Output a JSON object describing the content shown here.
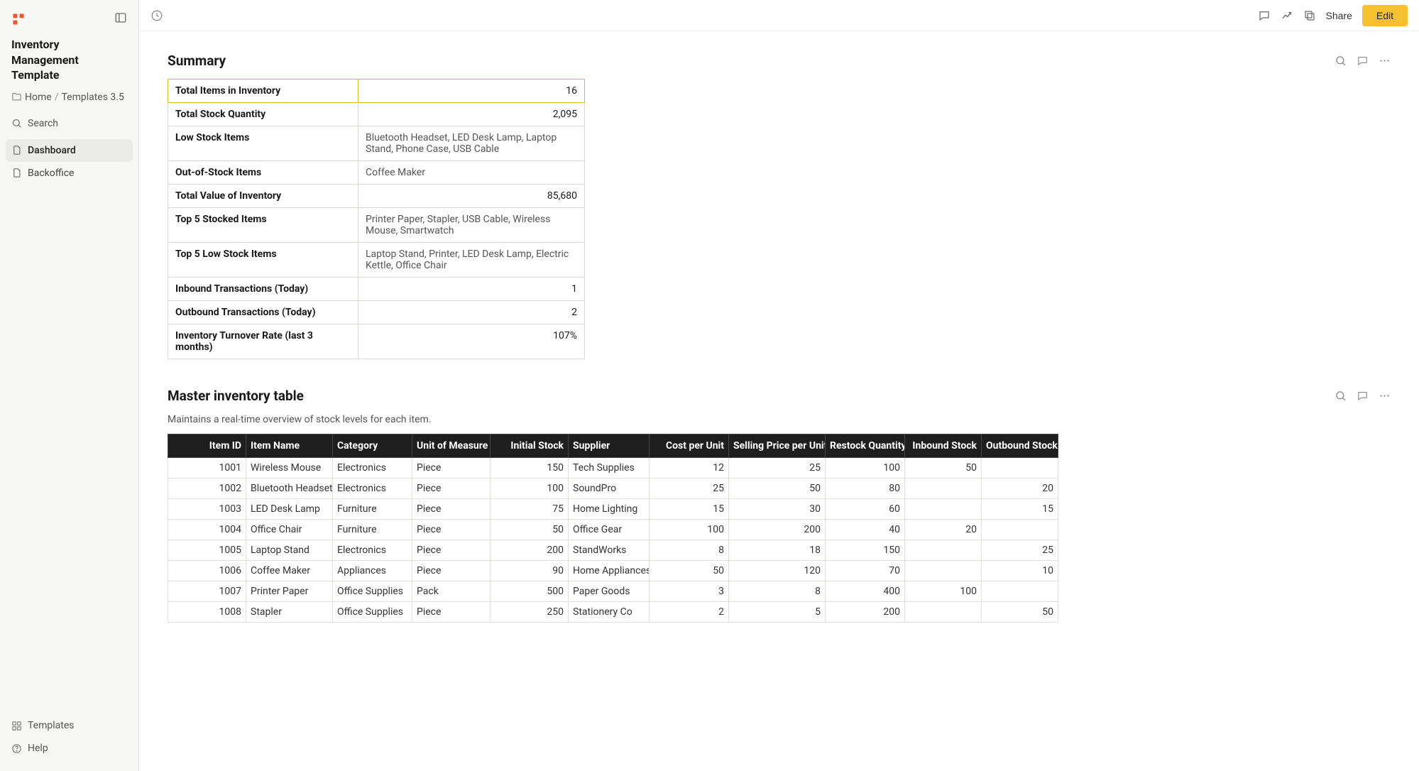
{
  "sidebar": {
    "title": "Inventory Management Template",
    "breadcrumb": {
      "home": "Home",
      "sep": "/",
      "current": "Templates 3.5"
    },
    "search": "Search",
    "nav": [
      {
        "label": "Dashboard",
        "active": true
      },
      {
        "label": "Backoffice",
        "active": false
      }
    ],
    "bottom": [
      {
        "label": "Templates"
      },
      {
        "label": "Help"
      }
    ]
  },
  "topbar": {
    "share": "Share",
    "edit": "Edit"
  },
  "summary": {
    "title": "Summary",
    "rows": [
      {
        "label": "Total Items in Inventory",
        "value": "16",
        "type": "num"
      },
      {
        "label": "Total Stock Quantity",
        "value": "2,095",
        "type": "num"
      },
      {
        "label": "Low Stock Items",
        "value": "Bluetooth Headset, LED Desk Lamp, Laptop Stand, Phone Case, USB Cable",
        "type": "txt"
      },
      {
        "label": "Out-of-Stock Items",
        "value": "Coffee Maker",
        "type": "txt"
      },
      {
        "label": "Total Value of Inventory",
        "value": "85,680",
        "type": "num"
      },
      {
        "label": "Top 5 Stocked Items",
        "value": "Printer Paper, Stapler, USB Cable, Wireless Mouse, Smartwatch",
        "type": "txt"
      },
      {
        "label": "Top 5 Low Stock Items",
        "value": "Laptop Stand, Printer, LED Desk Lamp, Electric Kettle, Office Chair",
        "type": "txt"
      },
      {
        "label": "Inbound Transactions (Today)",
        "value": "1",
        "type": "num"
      },
      {
        "label": "Outbound Transactions (Today)",
        "value": "2",
        "type": "num"
      },
      {
        "label": "Inventory Turnover Rate (last 3 months)",
        "value": "107%",
        "type": "num"
      }
    ]
  },
  "master": {
    "title": "Master inventory table",
    "desc": "Maintains a real-time overview of stock levels for each item.",
    "headers": [
      "Item ID",
      "Item Name",
      "Category",
      "Unit of Measure",
      "Initial Stock",
      "Supplier",
      "Cost per Unit",
      "Selling Price per Unit",
      "Restock Quantity",
      "Inbound Stock",
      "Outbound Stock"
    ],
    "rows": [
      {
        "id": "1001",
        "name": "Wireless Mouse",
        "cat": "Electronics",
        "uom": "Piece",
        "init": "150",
        "supp": "Tech Supplies",
        "cpu": "12",
        "spu": "25",
        "rq": "100",
        "in": "50",
        "out": ""
      },
      {
        "id": "1002",
        "name": "Bluetooth Headset",
        "cat": "Electronics",
        "uom": "Piece",
        "init": "100",
        "supp": "SoundPro",
        "cpu": "25",
        "spu": "50",
        "rq": "80",
        "in": "",
        "out": "20"
      },
      {
        "id": "1003",
        "name": "LED Desk Lamp",
        "cat": "Furniture",
        "uom": "Piece",
        "init": "75",
        "supp": "Home Lighting",
        "cpu": "15",
        "spu": "30",
        "rq": "60",
        "in": "",
        "out": "15"
      },
      {
        "id": "1004",
        "name": "Office Chair",
        "cat": "Furniture",
        "uom": "Piece",
        "init": "50",
        "supp": "Office Gear",
        "cpu": "100",
        "spu": "200",
        "rq": "40",
        "in": "20",
        "out": ""
      },
      {
        "id": "1005",
        "name": "Laptop Stand",
        "cat": "Electronics",
        "uom": "Piece",
        "init": "200",
        "supp": "StandWorks",
        "cpu": "8",
        "spu": "18",
        "rq": "150",
        "in": "",
        "out": "25"
      },
      {
        "id": "1006",
        "name": "Coffee Maker",
        "cat": "Appliances",
        "uom": "Piece",
        "init": "90",
        "supp": "Home Appliances",
        "cpu": "50",
        "spu": "120",
        "rq": "70",
        "in": "",
        "out": "10"
      },
      {
        "id": "1007",
        "name": "Printer Paper",
        "cat": "Office Supplies",
        "uom": "Pack",
        "init": "500",
        "supp": "Paper Goods",
        "cpu": "3",
        "spu": "8",
        "rq": "400",
        "in": "100",
        "out": ""
      },
      {
        "id": "1008",
        "name": "Stapler",
        "cat": "Office Supplies",
        "uom": "Piece",
        "init": "250",
        "supp": "Stationery Co",
        "cpu": "2",
        "spu": "5",
        "rq": "200",
        "in": "",
        "out": "50"
      }
    ]
  }
}
